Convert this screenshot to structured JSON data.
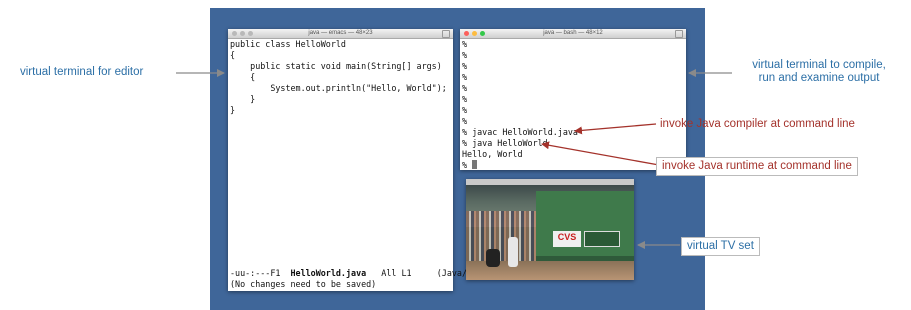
{
  "emacs": {
    "title": "java — emacs — 48×23",
    "code": "public class HelloWorld\n{\n    public static void main(String[] args)\n    {\n        System.out.println(\"Hello, World\");\n    }\n}",
    "modeline_prefix": "-uu-:---F1  ",
    "modeline_file": "HelloWorld.java",
    "modeline_suffix": "   All L1     (Java/l",
    "minibuffer": "(No changes need to be saved)"
  },
  "bash": {
    "title": "java — bash — 48×12",
    "output": "%\n%\n%\n%\n%\n%\n%\n%\n% javac HelloWorld.java\n% java HelloWorld\nHello, World\n% "
  },
  "annotations": {
    "editor": "virtual terminal for editor",
    "compile_line1": "virtual terminal to compile,",
    "compile_line2": "run and examine output",
    "compiler": "invoke Java compiler at command line",
    "runtime": "invoke Java runtime at command line",
    "tv": "virtual TV set"
  },
  "tv": {
    "sign": "CVS"
  },
  "colors": {
    "desktop": "#3f6699",
    "annotation_blue": "#2c6fa6",
    "annotation_red": "#a4322b"
  }
}
